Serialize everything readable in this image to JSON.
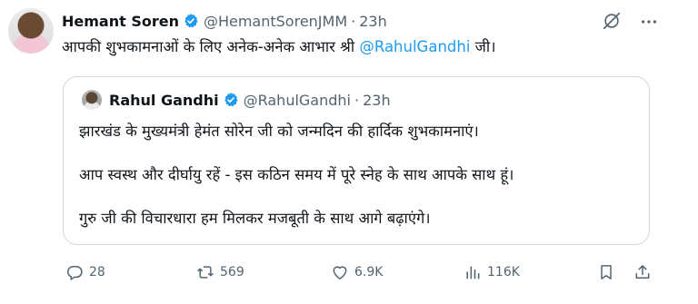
{
  "tweet": {
    "author_name": "Hemant Soren",
    "author_handle": "@HemantSorenJMM",
    "separator": "·",
    "time": "23h",
    "text_before": "आपकी शुभकामनाओं के लिए अनेक-अनेक आभार श्री ",
    "mention": "@RahulGandhi",
    "text_after": " जी।"
  },
  "quote": {
    "author_name": "Rahul Gandhi",
    "author_handle": "@RahulGandhi",
    "separator": "·",
    "time": "23h",
    "lines": [
      "झारखंड के मुख्यमंत्री हेमंत सोरेन जी को जन्मदिन की हार्दिक शुभकामनाएं।",
      "आप स्वस्थ और दीर्घायु रहें - इस कठिन समय में पूरे स्नेह के साथ आपके साथ हूं।",
      "गुरु जी की विचारधारा हम मिलकर मजबूती के साथ आगे बढ़ाएंगे।"
    ]
  },
  "actions": {
    "replies": "28",
    "reposts": "569",
    "likes": "6.9K",
    "views": "116K"
  },
  "colors": {
    "accent": "#1d9bf0",
    "secondary_text": "#536471",
    "border": "#cfd9de"
  }
}
